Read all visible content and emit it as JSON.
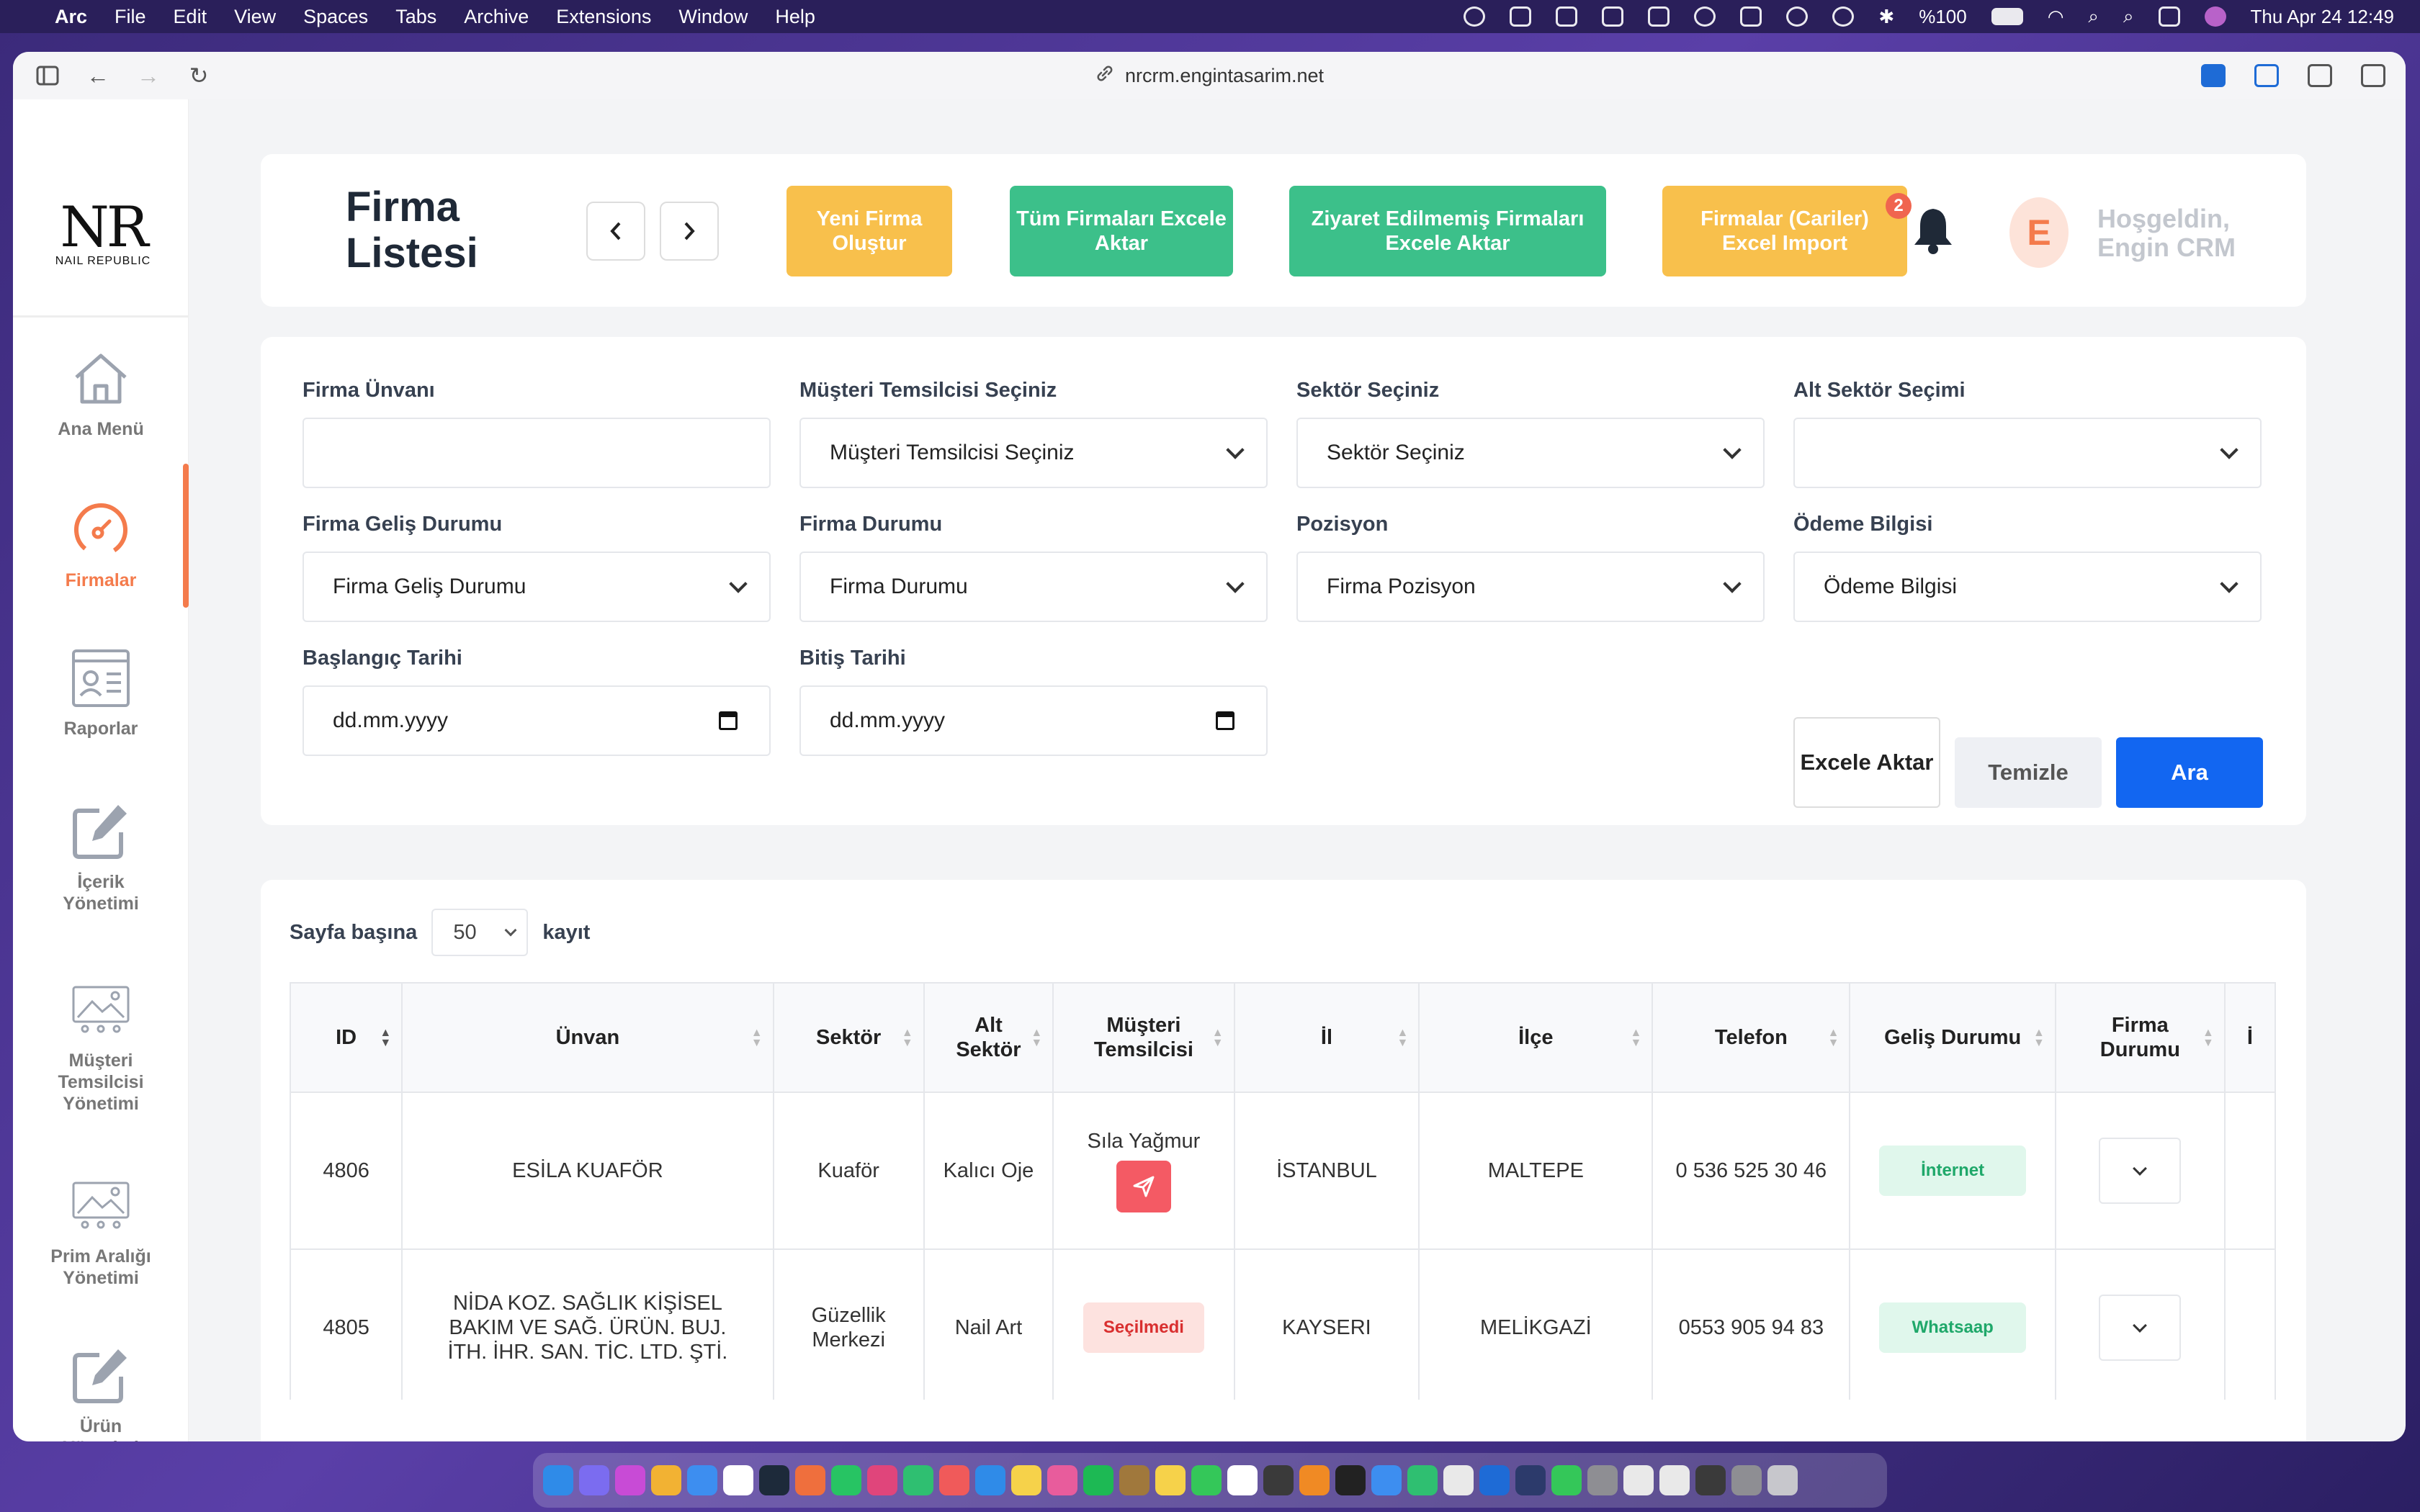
{
  "menubar": {
    "app_name": "Arc",
    "items": [
      "File",
      "Edit",
      "View",
      "Spaces",
      "Tabs",
      "Archive",
      "Extensions",
      "Window",
      "Help"
    ],
    "battery": "%100",
    "datetime": "Thu Apr 24  12:49"
  },
  "browser": {
    "url": "nrcrm.engintasarim.net"
  },
  "sidebar": {
    "logo_main": "NR",
    "logo_sub": "NAIL REPUBLIC",
    "items": [
      {
        "label": "Ana Menü"
      },
      {
        "label": "Firmalar"
      },
      {
        "label": "Raporlar"
      },
      {
        "label": "İçerik Yönetimi"
      },
      {
        "label": "Müşteri Temsilcisi Yönetimi"
      },
      {
        "label": "Prim Aralığı Yönetimi"
      },
      {
        "label": "Ürün Yönetimi"
      }
    ],
    "accent": "#f47b4c"
  },
  "header": {
    "title": "Firma Listesi",
    "buttons": {
      "new": "Yeni Firma Oluştur",
      "export_all": "Tüm Firmaları Excele Aktar",
      "export_unvisited": "Ziyaret Edilmemiş Firmaları Excele Aktar",
      "import": "Firmalar (Cariler) Excel Import"
    },
    "import_badge": "2",
    "avatar_letter": "E",
    "welcome_line1": "Hoşgeldin,",
    "welcome_line2": "Engin CRM"
  },
  "filters": {
    "firma_unvani": {
      "label": "Firma Ünvanı",
      "value": ""
    },
    "temsilci": {
      "label": "Müşteri Temsilcisi Seçiniz",
      "value": "Müşteri Temsilcisi Seçiniz"
    },
    "sektor": {
      "label": "Sektör Seçiniz",
      "value": "Sektör Seçiniz"
    },
    "alt_sektor": {
      "label": "Alt Sektör Seçimi",
      "value": ""
    },
    "gelis_durumu": {
      "label": "Firma Geliş Durumu",
      "value": "Firma Geliş Durumu"
    },
    "firma_durumu": {
      "label": "Firma Durumu",
      "value": "Firma Durumu"
    },
    "pozisyon": {
      "label": "Pozisyon",
      "value": "Firma Pozisyon"
    },
    "odeme": {
      "label": "Ödeme Bilgisi",
      "value": "Ödeme Bilgisi"
    },
    "baslangic": {
      "label": "Başlangıç Tarihi",
      "value": "dd.mm.yyyy"
    },
    "bitis": {
      "label": "Bitiş Tarihi",
      "value": "dd.mm.yyyy"
    },
    "btn_excel": "Excele Aktar",
    "btn_clear": "Temizle",
    "btn_search": "Ara"
  },
  "table": {
    "per_page_label": "Sayfa başına",
    "per_page_value": "50",
    "per_page_suffix": "kayıt",
    "columns": [
      "ID",
      "Ünvan",
      "Sektör",
      "Alt Sektör",
      "Müşteri Temsilcisi",
      "İl",
      "İlçe",
      "Telefon",
      "Geliş Durumu",
      "Firma Durumu",
      "İ"
    ],
    "rows": [
      {
        "id": "4806",
        "unvan": "ESİLA KUAFÖR",
        "sektor": "Kuaför",
        "alt_sektor": "Kalıcı Oje",
        "temsilci": "Sıla Yağmur",
        "il": "İSTANBUL",
        "ilce": "MALTEPE",
        "telefon": "0 536 525 30 46",
        "gelis": "İnternet"
      },
      {
        "id": "4805",
        "unvan": "NİDA KOZ. SAĞLIK KİŞİSEL BAKIM VE SAĞ. ÜRÜN. BUJ. İTH. İHR. SAN. TİC. LTD. ŞTİ.",
        "sektor": "Güzellik Merkezi",
        "alt_sektor": "Nail Art",
        "temsilci": "Seçilmedi",
        "il": "KAYSERI",
        "ilce": "MELİKGAZİ",
        "telefon": "0553 905 94 83",
        "gelis": "Whatsaap"
      }
    ]
  }
}
